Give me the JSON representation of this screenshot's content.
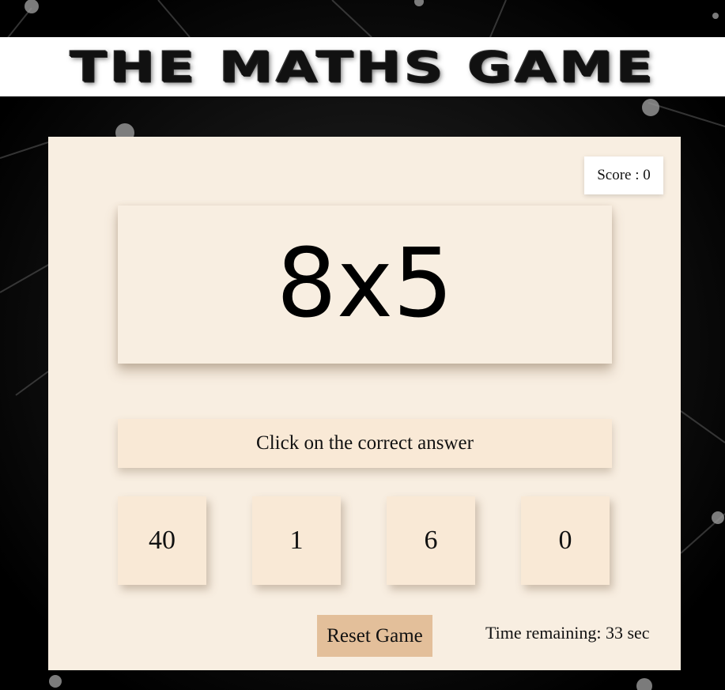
{
  "header": {
    "title": "THE MATHS GAME"
  },
  "score": {
    "text": "Score : 0"
  },
  "question": {
    "text": "8x5"
  },
  "instruction": {
    "text": "Click on the correct answer"
  },
  "choices": [
    "40",
    "1",
    "6",
    "0"
  ],
  "controls": {
    "reset_label": "Reset Game"
  },
  "timer": {
    "text": "Time remaining: 33 sec"
  },
  "colors": {
    "panel": "#f8eee1",
    "choice_box": "#f9e9d6",
    "reset_button": "#e3bf9a",
    "background": "#000000"
  }
}
